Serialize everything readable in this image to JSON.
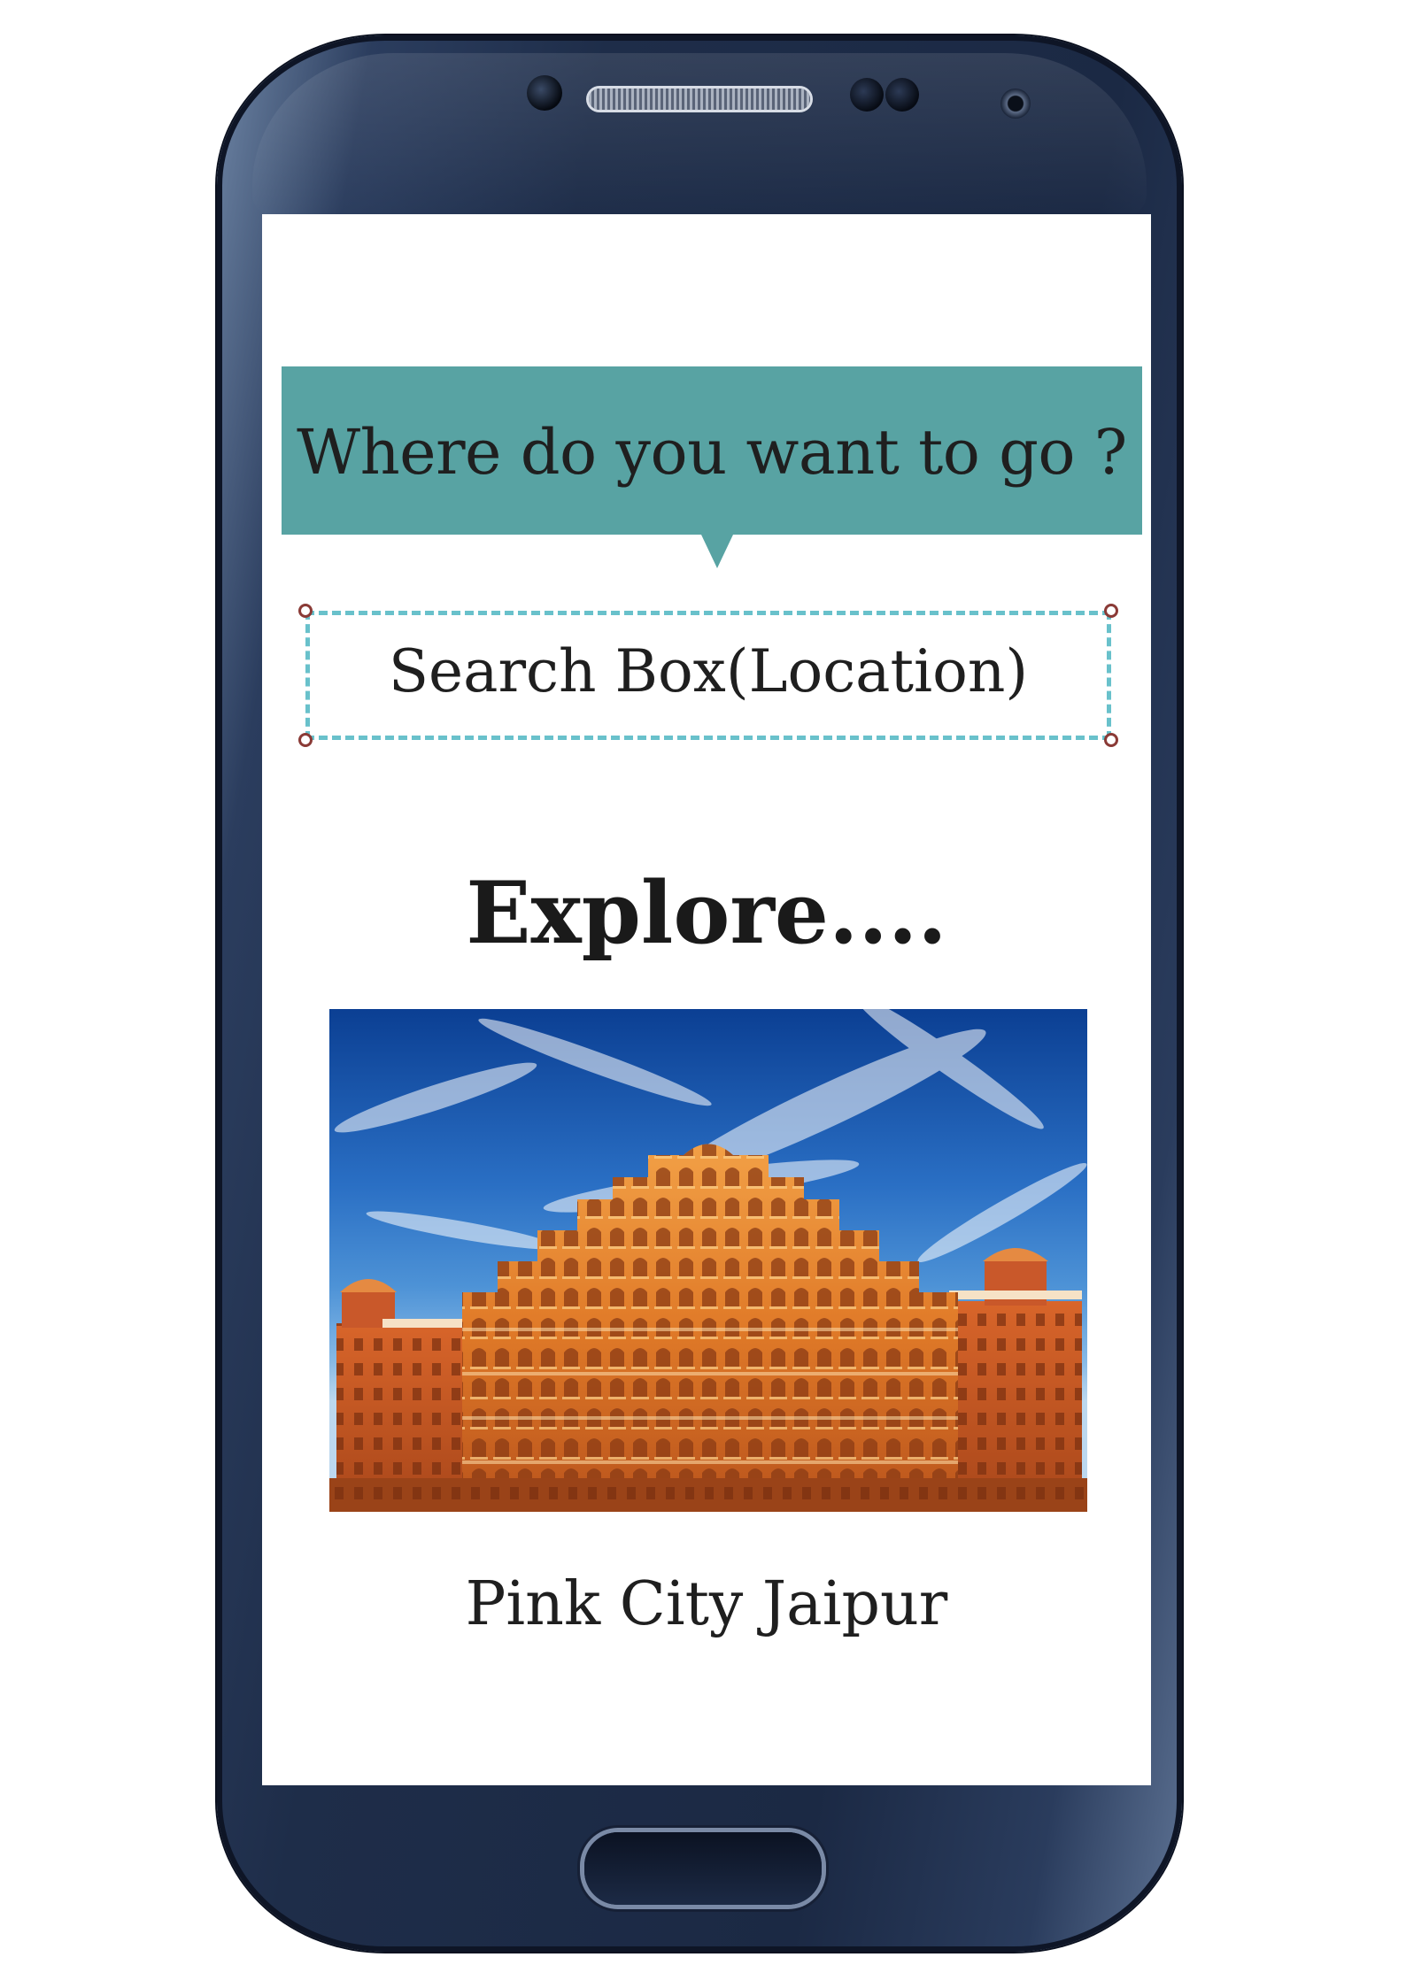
{
  "prompt": {
    "question": "Where do you want to go ?"
  },
  "search": {
    "label": "Search Box(Location)"
  },
  "explore": {
    "heading": "Explore...."
  },
  "feature": {
    "image_icon": "palace-photo",
    "caption": "Pink City Jaipur"
  },
  "colors": {
    "bubble": "#58a3a3",
    "search_border": "#69c1cb",
    "handle": "#8a3a36",
    "phone": "#1e2d49"
  }
}
